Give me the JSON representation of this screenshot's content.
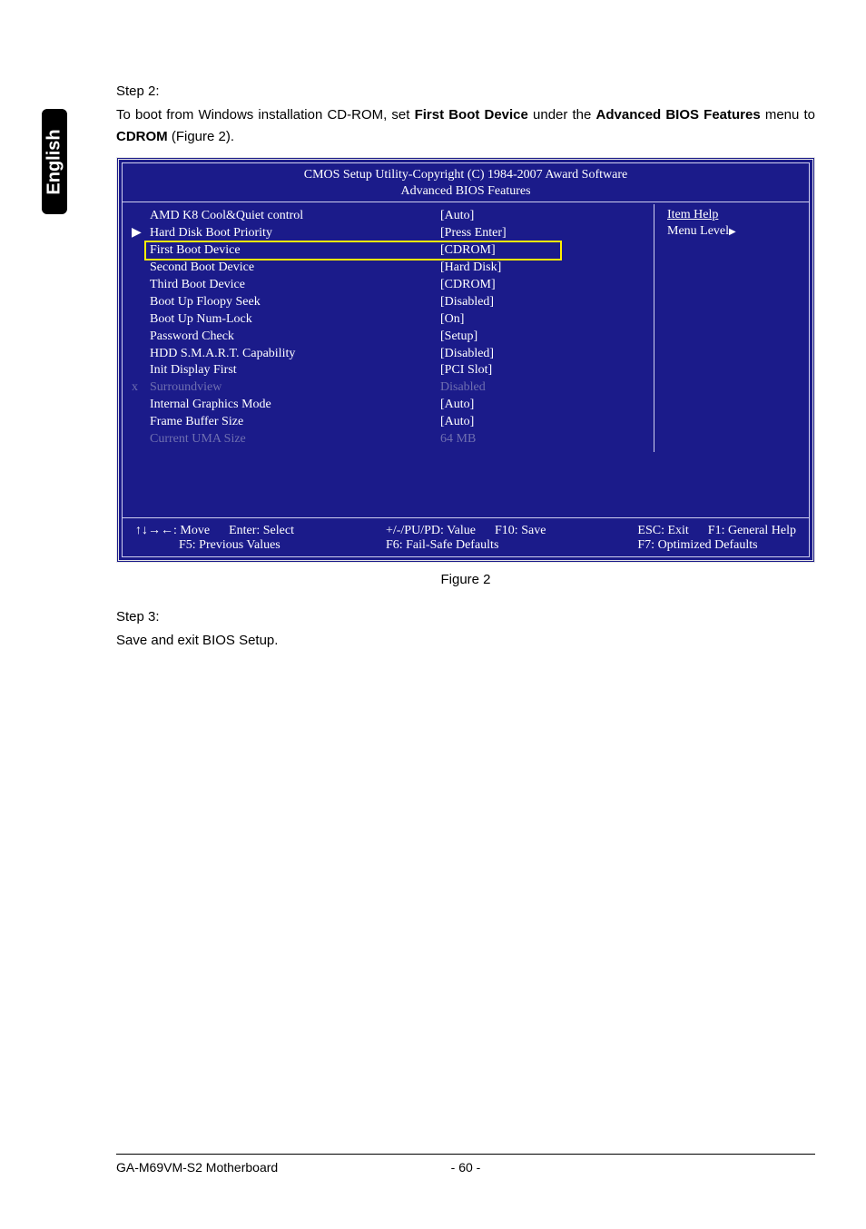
{
  "sideTab": "English",
  "step2": {
    "label": "Step 2:",
    "pre": "To boot from Windows installation CD-ROM, set ",
    "b1": "First Boot Device",
    "mid1": " under the ",
    "b2": "Advanced BIOS Features",
    "mid2": " menu to ",
    "b3": "CDROM",
    "post": " (Figure 2)."
  },
  "bios": {
    "title1": "CMOS Setup Utility-Copyright (C) 1984-2007 Award Software",
    "title2": "Advanced BIOS Features",
    "rows": [
      {
        "marker": "",
        "label": "AMD K8 Cool&Quiet control",
        "value": "[Auto]",
        "dim": false
      },
      {
        "marker": "▶",
        "label": "Hard Disk Boot Priority",
        "value": "[Press Enter]",
        "dim": false
      },
      {
        "marker": "",
        "label": "First Boot Device",
        "value": "[CDROM]",
        "dim": false
      },
      {
        "marker": "",
        "label": "Second Boot Device",
        "value": "[Hard Disk]",
        "dim": false
      },
      {
        "marker": "",
        "label": "Third Boot Device",
        "value": "[CDROM]",
        "dim": false
      },
      {
        "marker": "",
        "label": "Boot Up Floopy Seek",
        "value": "[Disabled]",
        "dim": false
      },
      {
        "marker": "",
        "label": "Boot Up Num-Lock",
        "value": "[On]",
        "dim": false
      },
      {
        "marker": "",
        "label": "Password Check",
        "value": "[Setup]",
        "dim": false
      },
      {
        "marker": "",
        "label": "HDD S.M.A.R.T. Capability",
        "value": "[Disabled]",
        "dim": false
      },
      {
        "marker": "",
        "label": "Init Display First",
        "value": "[PCI Slot]",
        "dim": false
      },
      {
        "marker": "x",
        "label": "Surroundview",
        "value": "Disabled",
        "dim": true
      },
      {
        "marker": "",
        "label": "Internal Graphics Mode",
        "value": "[Auto]",
        "dim": false
      },
      {
        "marker": "",
        "label": "Frame Buffer Size",
        "value": "[Auto]",
        "dim": false
      },
      {
        "marker": "",
        "label": "Current UMA Size",
        "value": "64 MB",
        "dim": true
      }
    ],
    "help": {
      "title": "Item Help",
      "level": "Menu Level"
    },
    "footer": {
      "c1a": "↑↓→←: Move",
      "c1b": "Enter: Select",
      "c1c": "F5: Previous Values",
      "c2a": "+/-/PU/PD: Value",
      "c2b": "F10: Save",
      "c2c": "F6: Fail-Safe Defaults",
      "c3a": "ESC: Exit",
      "c3b": "F1: General Help",
      "c3c": "F7: Optimized Defaults"
    }
  },
  "figCaption": "Figure 2",
  "step3": {
    "label": "Step 3:",
    "body": "Save and exit BIOS Setup."
  },
  "footer": {
    "left": "GA-M69VM-S2 Motherboard",
    "page": "- 60 -"
  }
}
